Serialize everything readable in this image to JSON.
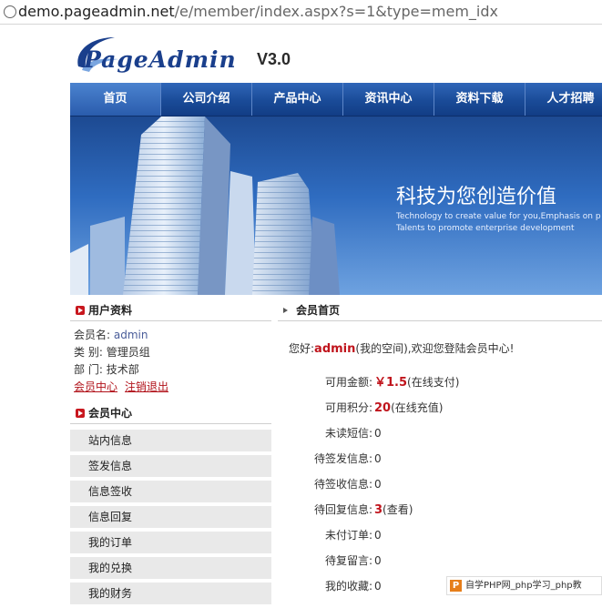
{
  "browser": {
    "url_host": "demo.pageadmin.net",
    "url_path": "/e/member/index.aspx?s=1&type=mem_idx"
  },
  "header": {
    "logo_text": "PageAdmin",
    "version": "V3.0"
  },
  "nav": {
    "items": [
      "首页",
      "公司介绍",
      "产品中心",
      "资讯中心",
      "资料下载",
      "人才招聘"
    ]
  },
  "banner": {
    "slogan": "科技为您创造价值",
    "sub_line1": "Technology to create value for you,Emphasis on p",
    "sub_line2": "Talents to promote enterprise development"
  },
  "user_profile": {
    "title": "用户资料",
    "member_name_label": "会员名:",
    "member_name": "admin",
    "type_label": "类  别:",
    "type_value": "管理员组",
    "dept_label": "部  门:",
    "dept_value": "技术部",
    "link_center": "会员中心",
    "link_logout": "注销退出"
  },
  "member_menu": {
    "title": "会员中心",
    "items": [
      "站内信息",
      "签发信息",
      "信息签收",
      "信息回复",
      "我的订单",
      "我的兑换",
      "我的财务"
    ]
  },
  "main": {
    "title": "会员首页",
    "greeting_prefix": "您好:",
    "username": "admin",
    "greeting_suffix": "(我的空间),欢迎您登陆会员中心!",
    "stats": [
      {
        "label": "可用金额:",
        "value": "￥1.5",
        "extra": "(在线支付)",
        "highlight": true
      },
      {
        "label": "可用积分:",
        "value": "20",
        "extra": "(在线充值)",
        "highlight": true
      },
      {
        "label": "未读短信:",
        "value": "0",
        "extra": "",
        "highlight": false
      },
      {
        "label": "待签发信息:",
        "value": "0",
        "extra": "",
        "highlight": false
      },
      {
        "label": "待签收信息:",
        "value": "0",
        "extra": "",
        "highlight": false
      },
      {
        "label": "待回复信息:",
        "value": "3",
        "extra": "(查看)",
        "highlight": true
      },
      {
        "label": "未付订单:",
        "value": "0",
        "extra": "",
        "highlight": false
      },
      {
        "label": "待复留言:",
        "value": "0",
        "extra": "",
        "highlight": false
      },
      {
        "label": "我的收藏:",
        "value": "0",
        "extra": "",
        "highlight": false
      }
    ]
  },
  "watermark": {
    "text": "自学PHP网_php学习_php教"
  }
}
